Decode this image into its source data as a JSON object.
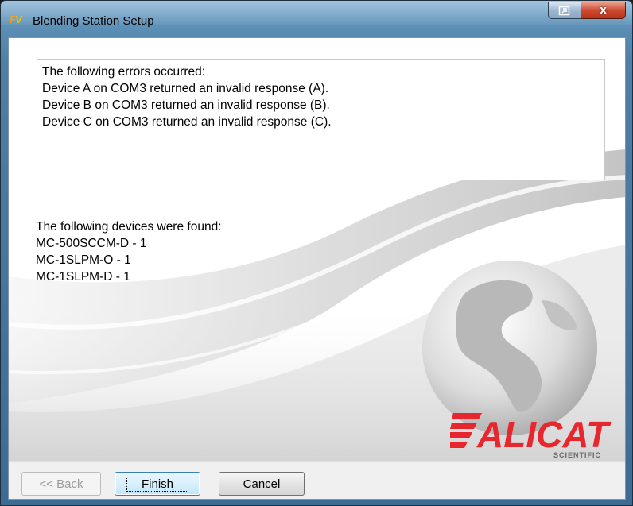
{
  "window": {
    "title": "Blending Station Setup",
    "icon_text_f": "F",
    "icon_text_v": "V",
    "close_glyph": "x"
  },
  "errors": {
    "lines": [
      "The following errors occurred:",
      "Device A on COM3 returned an invalid response (A).",
      "Device B on COM3 returned an invalid response (B).",
      "Device C on COM3 returned an invalid response (C)."
    ]
  },
  "devices": {
    "lines": [
      "The following devices were found:",
      "MC-500SCCM-D - 1",
      "MC-1SLPM-O - 1",
      "MC-1SLPM-D - 1"
    ]
  },
  "logo": {
    "brand": "ALICAT",
    "sub": "SCIENTIFIC",
    "brand_color": "#e8262d"
  },
  "buttons": {
    "back": "<< Back",
    "finish": "Finish",
    "cancel": "Cancel"
  },
  "icons": {
    "app": "fv-app-icon",
    "restore": "restore-icon",
    "close": "close-icon",
    "globe": "globe-icon"
  }
}
